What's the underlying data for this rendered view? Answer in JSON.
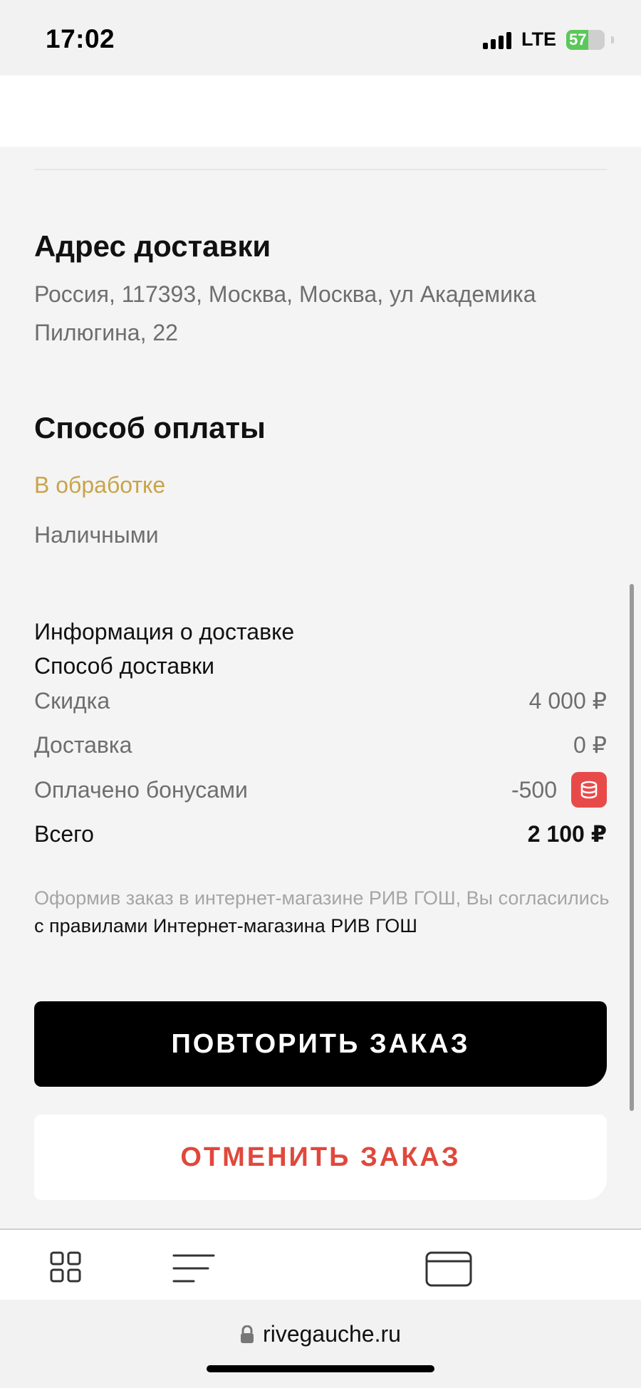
{
  "status_bar": {
    "time": "17:02",
    "network": "LTE",
    "battery": "57",
    "battery_level": 0.57
  },
  "address": {
    "title": "Адрес доставки",
    "text": "Россия, 117393, Москва, Москва, ул Академика Пилюгина, 22"
  },
  "payment": {
    "title": "Способ оплаты",
    "status": "В обработке",
    "method": "Наличными"
  },
  "delivery_info": {
    "info_label": "Информация о доставке",
    "method_label": "Способ доставки"
  },
  "summary": {
    "discount_label": "Скидка",
    "discount_value": "4 000 ₽",
    "delivery_label": "Доставка",
    "delivery_value": "0 ₽",
    "bonus_label": "Оплачено бонусами",
    "bonus_value": "-500",
    "total_label": "Всего",
    "total_value": "2 100 ₽"
  },
  "agreement": {
    "text": "Оформив заказ в интернет-магазине РИВ ГОШ, Вы согласились ",
    "link": "с правилами Интернет-магазина РИВ ГОШ"
  },
  "actions": {
    "repeat": "ПОВТОРИТЬ ЗАКАЗ",
    "cancel": "ОТМЕНИТЬ ЗАКАЗ"
  },
  "browser": {
    "url": "rivegauche.ru"
  },
  "colors": {
    "processing": "#c8a44a",
    "cancel": "#e0483c",
    "bonus_icon": "#e84a4a"
  }
}
